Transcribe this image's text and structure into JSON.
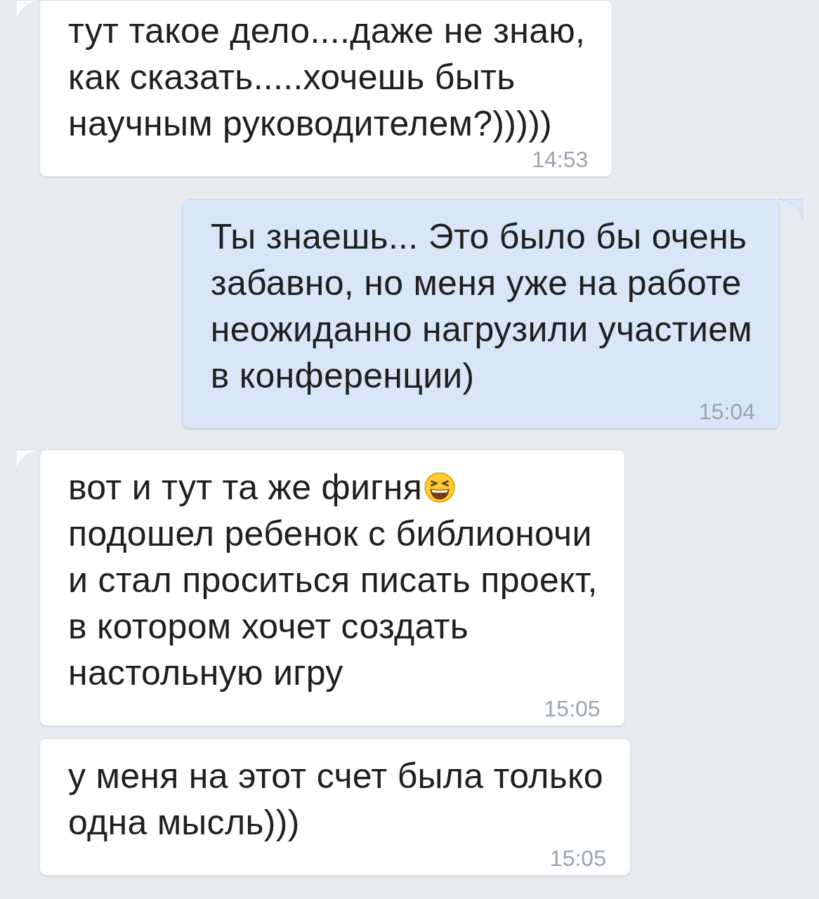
{
  "messages": [
    {
      "kind": "incoming",
      "tail": true,
      "text": "тут такое дело....даже не знаю,\nкак сказать.....хочешь быть\nнаучным руководителем?)))))",
      "time": "14:53"
    },
    {
      "kind": "outgoing",
      "tail": true,
      "text": "Ты знаешь... Это было бы очень\nзабавно, но меня уже на работе\nнеожиданно нагрузили участием\nв конференции)",
      "time": "15:04"
    },
    {
      "kind": "incoming",
      "tail": true,
      "text": "вот и тут та же фигня",
      "emoji": true,
      "continuation": "подошел ребенок с библионочи\nи стал проситься писать проект,\nв котором хочет создать\nнастольную игру",
      "time": "15:05"
    },
    {
      "kind": "incoming",
      "tail": false,
      "text": "у меня на этот счет была только\nодна мысль)))",
      "time": "15:05"
    }
  ]
}
